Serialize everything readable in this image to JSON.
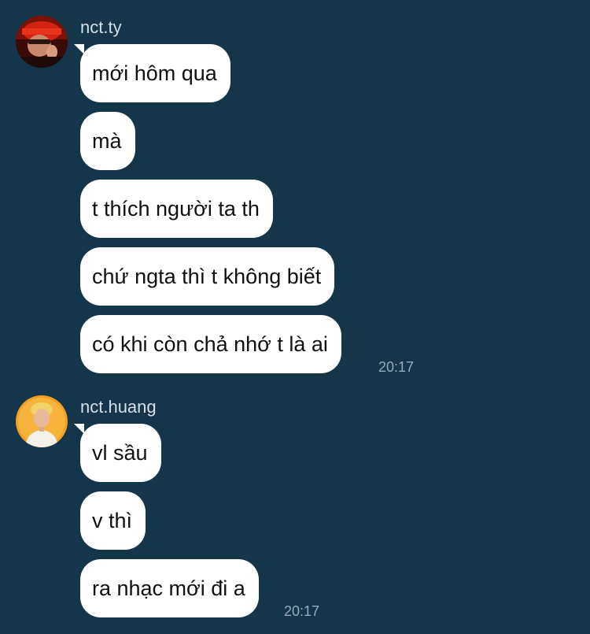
{
  "conversation": {
    "groups": [
      {
        "sender": "nct.ty",
        "avatar_icon": "profile-photo-red",
        "messages": [
          "mới hôm qua",
          "mà",
          "t thích người ta th",
          "chứ ngta thì t không biết",
          "có khi còn chả nhớ t là ai"
        ],
        "time": "20:17"
      },
      {
        "sender": "nct.huang",
        "avatar_icon": "profile-photo-orange",
        "messages": [
          "vl sầu",
          "v thì",
          "ra nhạc mới đi a"
        ],
        "time": "20:17"
      }
    ]
  },
  "colors": {
    "background": "#14354a",
    "bubble": "#ffffff",
    "sender_text": "#d6dfe6",
    "time_text": "#98abb8"
  }
}
